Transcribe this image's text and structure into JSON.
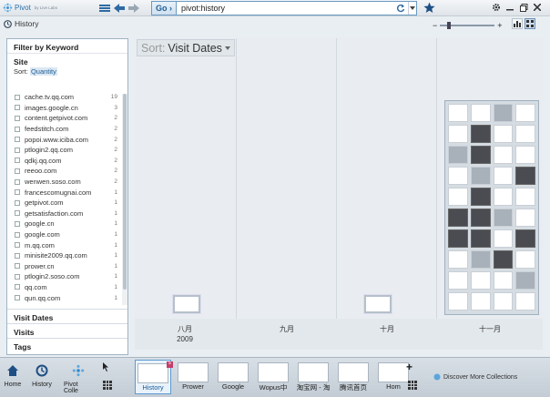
{
  "app": {
    "name": "Pivot",
    "byline": "by Live Labs"
  },
  "address": {
    "go_label": "Go",
    "url": "pivot:history"
  },
  "history": {
    "label": "History"
  },
  "filter": {
    "title": "Filter by Keyword",
    "site_header": "Site",
    "sort_label": "Sort:",
    "sort_value": "Quantity",
    "sites": [
      {
        "name": "cache.tv.qq.com",
        "count": "19"
      },
      {
        "name": "images.google.cn",
        "count": "3"
      },
      {
        "name": "content.getpivot.com",
        "count": "2"
      },
      {
        "name": "feedstitch.com",
        "count": "2"
      },
      {
        "name": "popoi.www.iciba.com",
        "count": "2"
      },
      {
        "name": "ptlogin2.qq.com",
        "count": "2"
      },
      {
        "name": "qdkj.qq.com",
        "count": "2"
      },
      {
        "name": "reeoo.com",
        "count": "2"
      },
      {
        "name": "wenwen.soso.com",
        "count": "2"
      },
      {
        "name": "francescomugnai.com",
        "count": "1"
      },
      {
        "name": "getpivot.com",
        "count": "1"
      },
      {
        "name": "getsatisfaction.com",
        "count": "1"
      },
      {
        "name": "google.cn",
        "count": "1"
      },
      {
        "name": "google.com",
        "count": "1"
      },
      {
        "name": "m.qq.com",
        "count": "1"
      },
      {
        "name": "minisite2009.qq.com",
        "count": "1"
      },
      {
        "name": "prower.cn",
        "count": "1"
      },
      {
        "name": "ptlogin2.soso.com",
        "count": "1"
      },
      {
        "name": "qq.com",
        "count": "1"
      },
      {
        "name": "qun.qq.com",
        "count": "1"
      }
    ],
    "facets": [
      "Visit Dates",
      "Visits",
      "Tags"
    ]
  },
  "main": {
    "sort_label": "Sort:",
    "sort_value": "Visit Dates",
    "columns": [
      {
        "label": "八月",
        "sub": "2009"
      },
      {
        "label": "九月",
        "sub": ""
      },
      {
        "label": "十月",
        "sub": ""
      },
      {
        "label": "十一月",
        "sub": ""
      }
    ]
  },
  "bottom": {
    "home_label": "Home",
    "history_label": "History",
    "pivot_label": "Pivot Colle",
    "tabs": [
      "History",
      "Prower",
      "Google",
      "Wopus中",
      "淘宝网 - 淘",
      "腾讯首页",
      "Hom"
    ],
    "discover_label": "Discover More Collections"
  }
}
